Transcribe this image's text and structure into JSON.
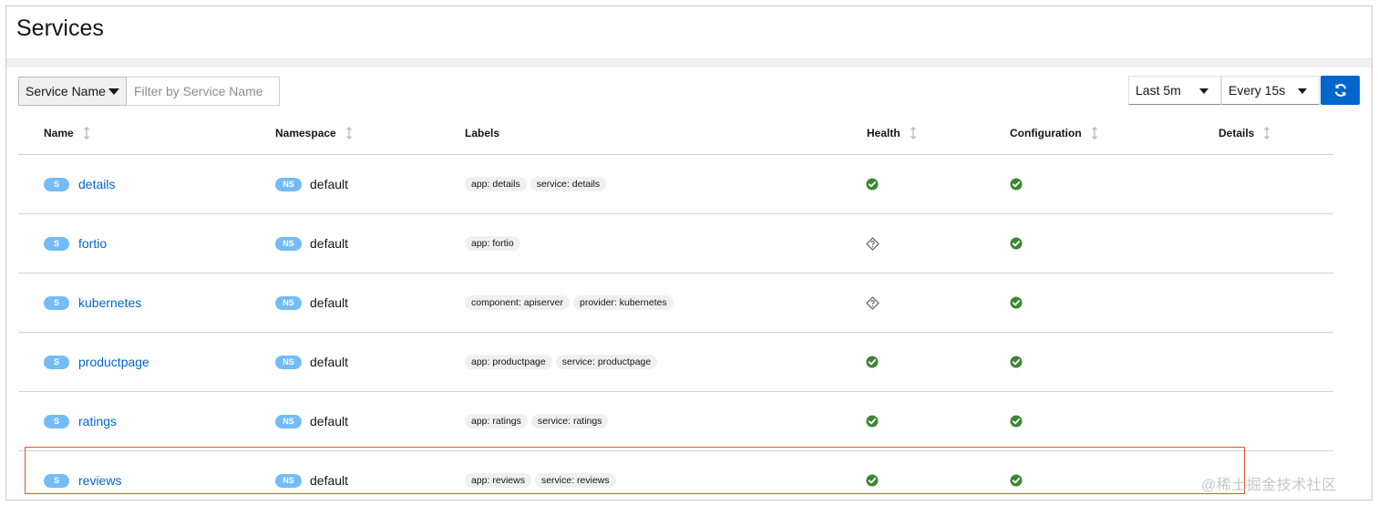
{
  "page": {
    "title": "Services"
  },
  "toolbar": {
    "filter_type": "Service Name",
    "filter_placeholder": "Filter by Service Name",
    "interval": "Last 5m",
    "refresh": "Every 15s"
  },
  "table": {
    "headers": {
      "name": "Name",
      "namespace": "Namespace",
      "labels": "Labels",
      "health": "Health",
      "configuration": "Configuration",
      "details": "Details"
    },
    "rows": [
      {
        "badge": "S",
        "name": "details",
        "ns_badge": "NS",
        "namespace": "default",
        "labels": [
          "app: details",
          "service: details"
        ],
        "health": "healthy",
        "config": "valid"
      },
      {
        "badge": "S",
        "name": "fortio",
        "ns_badge": "NS",
        "namespace": "default",
        "labels": [
          "app: fortio"
        ],
        "health": "unknown",
        "config": "valid"
      },
      {
        "badge": "S",
        "name": "kubernetes",
        "ns_badge": "NS",
        "namespace": "default",
        "labels": [
          "component: apiserver",
          "provider: kubernetes"
        ],
        "health": "unknown",
        "config": "valid"
      },
      {
        "badge": "S",
        "name": "productpage",
        "ns_badge": "NS",
        "namespace": "default",
        "labels": [
          "app: productpage",
          "service: productpage"
        ],
        "health": "healthy",
        "config": "valid"
      },
      {
        "badge": "S",
        "name": "ratings",
        "ns_badge": "NS",
        "namespace": "default",
        "labels": [
          "app: ratings",
          "service: ratings"
        ],
        "health": "healthy",
        "config": "valid"
      },
      {
        "badge": "S",
        "name": "reviews",
        "ns_badge": "NS",
        "namespace": "default",
        "labels": [
          "app: reviews",
          "service: reviews"
        ],
        "health": "healthy",
        "config": "valid"
      }
    ]
  },
  "colors": {
    "link": "#0066cc",
    "badge": "#73bcf7",
    "healthy": "#3e8635",
    "highlight": "#e4572e",
    "primary_button": "#0066cc"
  },
  "watermark": "@稀土掘金技术社区"
}
